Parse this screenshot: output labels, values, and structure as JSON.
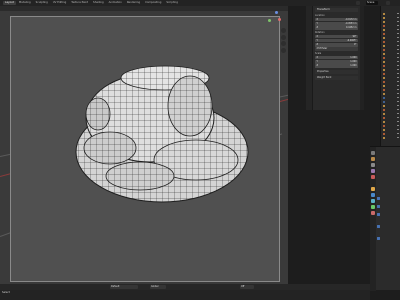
{
  "workspaces": [
    "Layout",
    "Modeling",
    "Sculpting",
    "UV Editing",
    "Texture Paint",
    "Shading",
    "Animation",
    "Rendering",
    "Compositing",
    "Scripting"
  ],
  "scene": {
    "label": "Scene"
  },
  "npanel": {
    "header": "Transform",
    "location_label": "Location",
    "location": [
      {
        "axis": "X",
        "value": "-0.0172 m"
      },
      {
        "axis": "Y",
        "value": "-0.4553 m"
      },
      {
        "axis": "Z",
        "value": "0.4452 m"
      }
    ],
    "rotation_label": "Rotation",
    "rotation": [
      {
        "axis": "X",
        "value": "90°"
      },
      {
        "axis": "Y",
        "value": "-0.0005°"
      },
      {
        "axis": "Z",
        "value": "0°"
      }
    ],
    "mode_value": "XYZ Euler",
    "scale_label": "Scale",
    "scale": [
      {
        "axis": "X",
        "value": "1.000"
      },
      {
        "axis": "Y",
        "value": "1.000"
      },
      {
        "axis": "Z",
        "value": "1.000"
      }
    ],
    "sections": [
      "Properties",
      "Weight Paint"
    ]
  },
  "bottombar": {
    "select": "Default",
    "value1": "Global",
    "value2": "Off"
  },
  "status": {
    "left_text": "Select"
  },
  "colors": {
    "accent": "#4772b3",
    "frame": "#505050",
    "viewport": "#3a3a3a",
    "mesh": "#d9d9d9",
    "wire": "#222222",
    "x_axis": "#e06b6b",
    "y_axis": "#7ec36a",
    "z_axis": "#6b8fe0"
  }
}
